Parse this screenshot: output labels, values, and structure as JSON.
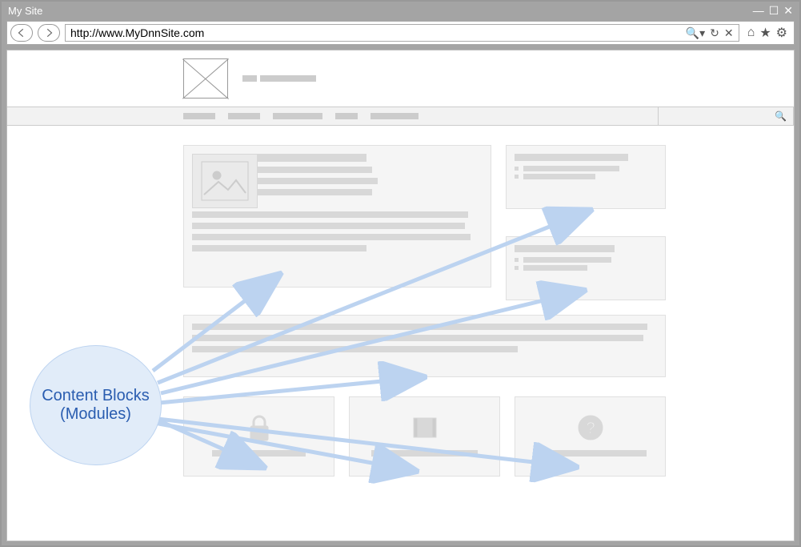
{
  "window": {
    "title": "My Site"
  },
  "url": "http://www.MyDnnSite.com",
  "annotation": {
    "label": "Content Blocks (Modules)"
  }
}
